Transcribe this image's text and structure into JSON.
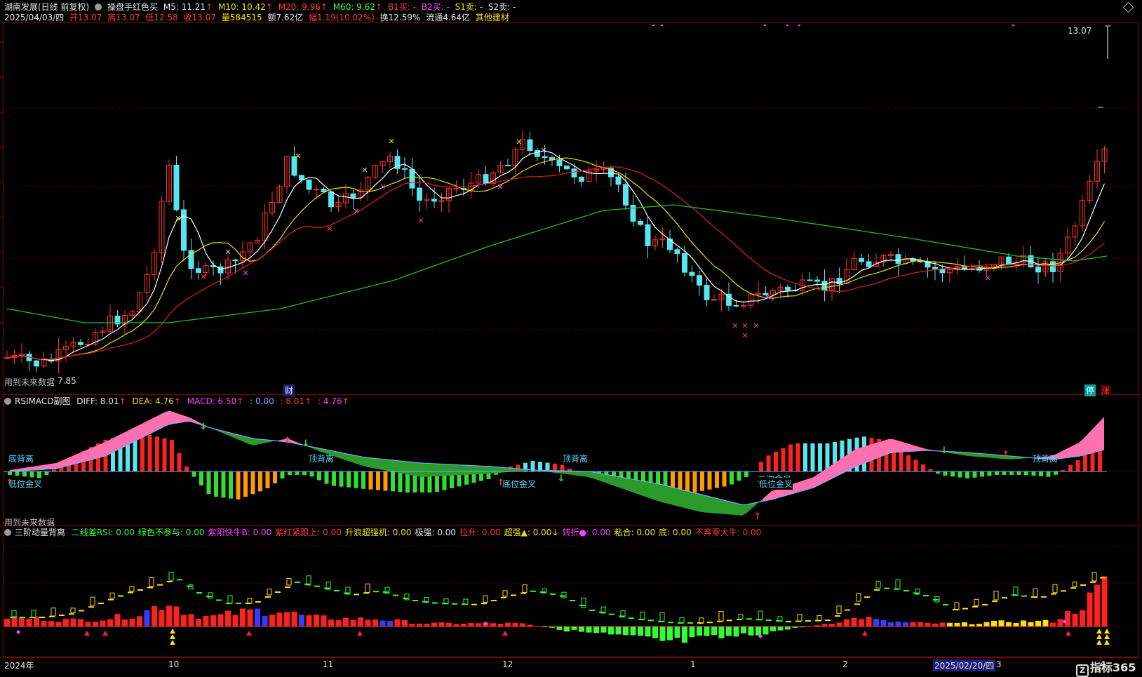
{
  "header": {
    "title": "湖南发展(日线 前复权)",
    "indicator": "操盘手红色买",
    "ma5": "M5: 11.21",
    "ma10": "M10: 10.42",
    "ma20": "M20: 9.96",
    "ma60": "M60: 9.62",
    "b1": "B1买: -",
    "b2": "B2买: -",
    "s1": "S1卖: -",
    "s2": "S2卖: -",
    "date": "2025/04/03/四",
    "open": "开13.07",
    "high": "高13.07",
    "low": "低12.58",
    "close": "收13.07",
    "volume": "量584515",
    "amount": "额7.62亿",
    "change": "幅1.19(10.02%)",
    "turnover": "换12.59%",
    "float": "流通4.64亿",
    "sector": "其他建材"
  },
  "main_panel": {
    "price_label": "13.07",
    "low_label": "7.85",
    "future_data_note": "用到未来数据",
    "cai_badge": "财",
    "ting_badge": "停",
    "zhang_badge": "涨"
  },
  "macd_panel": {
    "title": "RSIMACD副图",
    "diff": "DIFF: 8.01",
    "dea": "DEA: 4.76",
    "macd": "MACD: 6.50",
    "v1": ": 0.00",
    "v2": ": 8.01",
    "v3": ": 4.76",
    "future_data_note": "用到未来数据",
    "labels": [
      "底背离",
      "低位金叉",
      "顶背离",
      "底位金叉",
      "顶背离",
      "二次金叉",
      "低位金叉",
      "顶背离"
    ]
  },
  "mom_panel": {
    "title": "三阶动量背离",
    "items": [
      {
        "text": "二线差RSI: 0.00",
        "color": "#3cff3c"
      },
      {
        "text": "绿色不参与: 0.00",
        "color": "#3cff3c"
      },
      {
        "text": "紫阳快牛B: 0.00",
        "color": "#ff40ff"
      },
      {
        "text": "紫红紧跟上: 0.00",
        "color": "#ff3b3b"
      },
      {
        "text": "升浪超强机: 0.00",
        "color": "#f0e000"
      },
      {
        "text": "极强: 0.00",
        "color": "#e6e6e6"
      },
      {
        "text": "拉升: 0.00",
        "color": "#ff3b3b"
      },
      {
        "text": "超强▲: 0.00↓",
        "color": "#f0e000"
      },
      {
        "text": "转折●: 0.00",
        "color": "#ff40ff"
      },
      {
        "text": "粘合: 0.00",
        "color": "#f0e000"
      },
      {
        "text": "底: 0.00",
        "color": "#f0e000"
      },
      {
        "text": "不弃零大牛: 0.00",
        "color": "#ff3b3b"
      }
    ]
  },
  "time_axis": {
    "labels": [
      "2024年",
      "10",
      "11",
      "12",
      "1",
      "2",
      "2025/02/20/四",
      "3",
      "4"
    ]
  },
  "watermark": "指标365"
}
